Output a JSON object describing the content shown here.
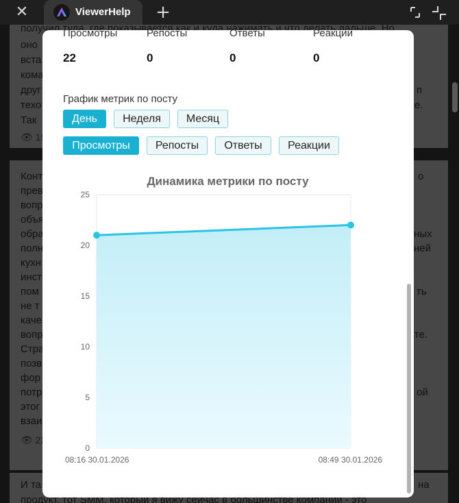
{
  "app": {
    "tab_title": "ViewerHelp"
  },
  "feed": {
    "card1_lines": [
      "получил туда, где показывается как и куда нажимать и что делать дальше. Но",
      "оно",
      "вста",
      "кома",
      "друг",
      "техо",
      "Так"
    ],
    "card1_right_fragments": [
      "п",
      "ухе."
    ],
    "card1_views": "19",
    "card2_lines": [
      "Конт",
      "прев",
      "вопр",
      "объя",
      "обра",
      "полн",
      "кухн",
      "инст",
      "пом",
      "не т",
      "каче",
      "вопр",
      "Стра",
      "позв",
      "фор",
      "потр",
      "этог",
      "взаи"
    ],
    "card2_right_fragments": [
      "о",
      "ных",
      "ней",
      "ть",
      "кте.",
      "ой"
    ],
    "card2_views": "22",
    "card3_lines": [
      "И та",
      "продукт, тот SMM, который я вижу сейчас в большинстве компаний - это"
    ],
    "card3_right_fragment": "на"
  },
  "modal": {
    "stats": [
      {
        "label": "Просмотры",
        "value": "22"
      },
      {
        "label": "Репосты",
        "value": "0"
      },
      {
        "label": "Ответы",
        "value": "0"
      },
      {
        "label": "Реакции",
        "value": "0"
      }
    ],
    "chart_section_title": "График метрик по посту",
    "period_buttons": [
      "День",
      "Неделя",
      "Месяц"
    ],
    "metric_buttons": [
      "Просмотры",
      "Репосты",
      "Ответы",
      "Реакции"
    ]
  },
  "colors": {
    "accent": "#1ab0d2",
    "line": "#29c4e6",
    "area": "#c3eef7"
  },
  "chart_data": {
    "type": "area",
    "title": "Динамика метрики по посту",
    "x": [
      "08:16 30.01.2026",
      "08:49 30.01.2026"
    ],
    "series": [
      {
        "values": [
          21,
          22
        ]
      }
    ],
    "ylim": [
      0,
      25
    ],
    "yticks": [
      0,
      5,
      10,
      15,
      20,
      25
    ],
    "grid": true
  }
}
